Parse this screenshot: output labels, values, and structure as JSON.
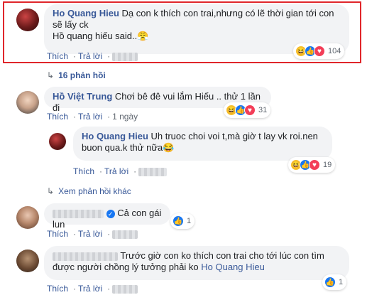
{
  "comments": [
    {
      "name": "Ho Quang Hieu",
      "text_line1": "Dạ con k thích con trai,nhưng có lẽ thời gian tới con",
      "text_line2": "sẽ lấy ck",
      "text_line3": "Hồ quang hiếu said..😤",
      "actions": [
        "Thích",
        "Trả lời"
      ],
      "reaction_count": "104"
    },
    {
      "name": "Hồ Việt Trung",
      "text": "Chơi bê đê vui lắm Hiếu .. thử 1 lần đi",
      "actions": [
        "Thích",
        "Trả lời"
      ],
      "time": "1 ngày",
      "reaction_count": "31"
    },
    {
      "name": "Ho Quang Hieu",
      "text_line1": "Uh truoc choi voi t,mà giờ t lay vk roi.nen",
      "text_line2": "buon qua.k thử nữa😂",
      "actions": [
        "Thích",
        "Trả lời"
      ],
      "reaction_count": "19"
    },
    {
      "text": "Cả con gái lun",
      "actions": [
        "Thích",
        "Trả lời"
      ],
      "reaction_count": "1"
    },
    {
      "text_line1": "Trước giờ con ko thích con trai cho tới lúc con tìm",
      "text_line2": "được người chồng lý tưởng phải ko",
      "mention": "Ho Quang Hieu",
      "actions": [
        "Thích",
        "Trả lời"
      ],
      "reaction_count": "1"
    }
  ],
  "replies_link": "16 phản hồi",
  "more_replies": "Xem phản hồi khác",
  "colors": {
    "link": "#385898",
    "highlight": "#e0262b",
    "bubble": "#f2f3f5"
  },
  "icons": [
    "haha-reaction-icon",
    "like-reaction-icon",
    "love-reaction-icon",
    "reply-arrow-icon",
    "verified-check-icon"
  ]
}
